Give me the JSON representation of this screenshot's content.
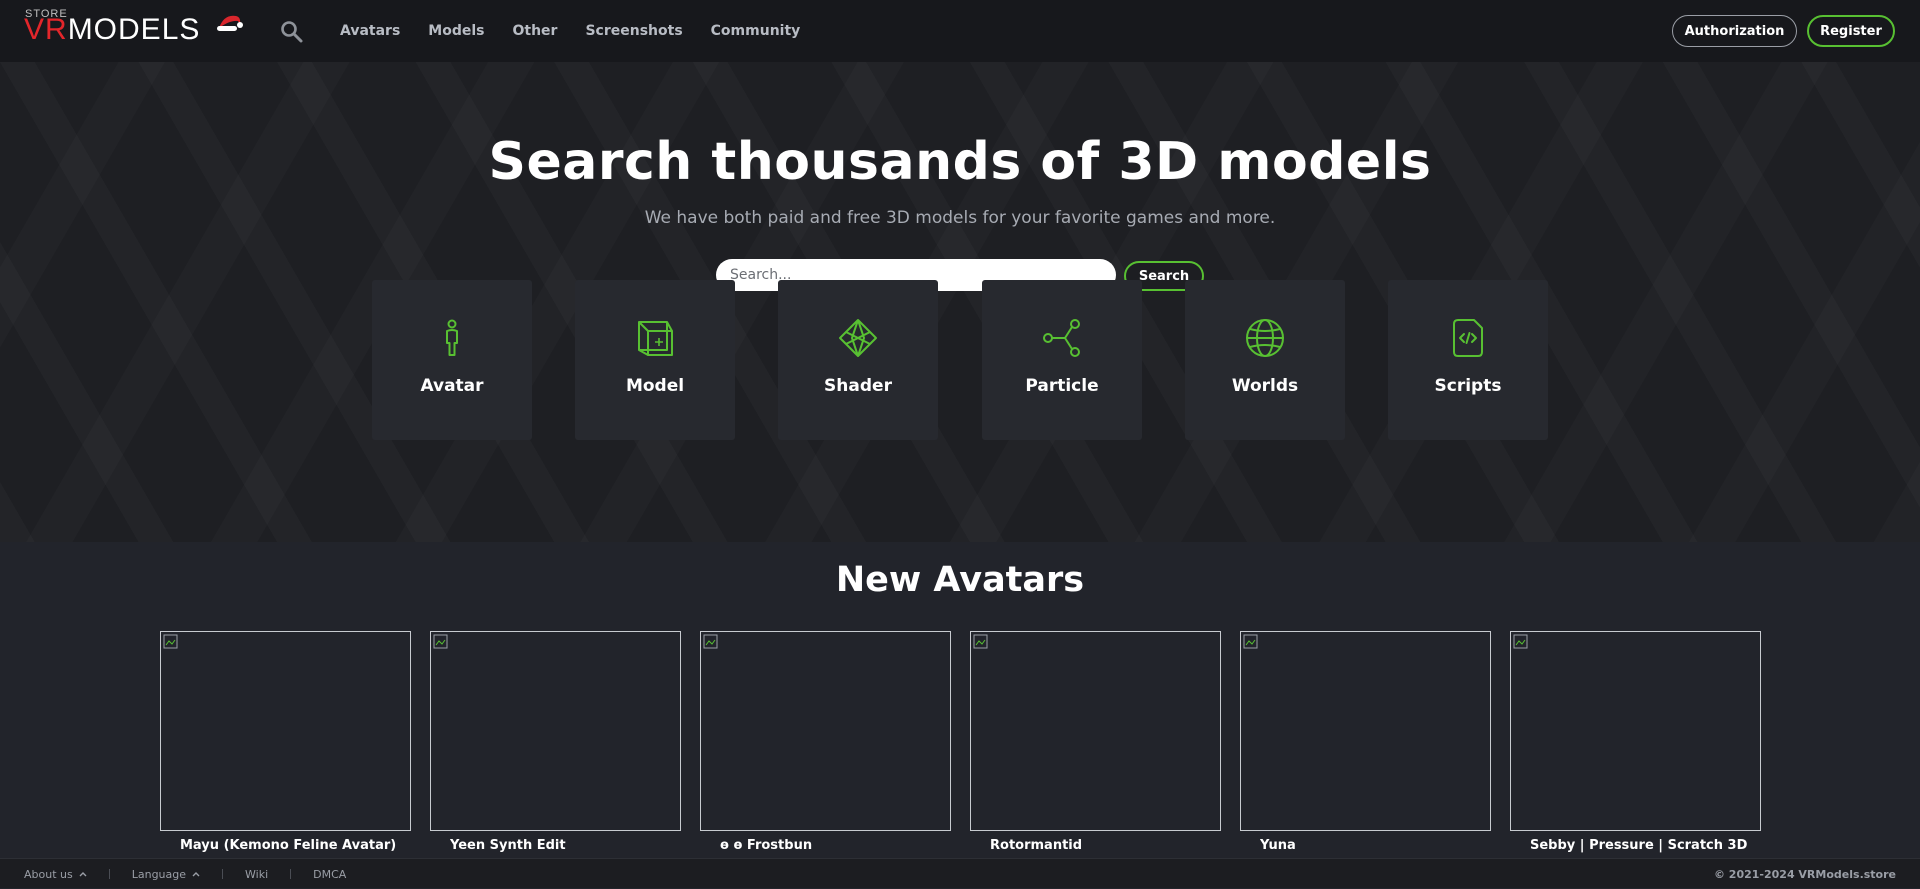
{
  "header": {
    "logo": {
      "store": "STORE",
      "vr": "VR",
      "models": "MODELS"
    },
    "nav": [
      "Avatars",
      "Models",
      "Other",
      "Screenshots",
      "Community"
    ],
    "auth_label": "Authorization",
    "register_label": "Register"
  },
  "hero": {
    "title": "Search thousands of 3D models",
    "subtitle": "We have both paid and free 3D models for your favorite games and more.",
    "search_placeholder": "Search...",
    "search_button": "Search"
  },
  "categories": [
    {
      "label": "Avatar",
      "icon": "person-icon"
    },
    {
      "label": "Model",
      "icon": "cube-icon"
    },
    {
      "label": "Shader",
      "icon": "diamond-icon"
    },
    {
      "label": "Particle",
      "icon": "share-nodes-icon"
    },
    {
      "label": "Worlds",
      "icon": "globe-icon"
    },
    {
      "label": "Scripts",
      "icon": "code-file-icon"
    }
  ],
  "new_avatars": {
    "title": "New Avatars",
    "items": [
      "Mayu (Kemono Feline Avatar)",
      "Yeen Synth Edit",
      "ɵ ɵ Frostbun",
      "Rotormantid",
      "Yuna",
      "Sebby | Pressure | Scratch 3D"
    ]
  },
  "footer": {
    "about": "About us",
    "language": "Language",
    "wiki": "Wiki",
    "dmca": "DMCA",
    "copyright": "© 2021-2024 VRModels.store"
  },
  "colors": {
    "accent": "#58c032",
    "logo_red": "#e3262b",
    "background": "#22242b"
  }
}
